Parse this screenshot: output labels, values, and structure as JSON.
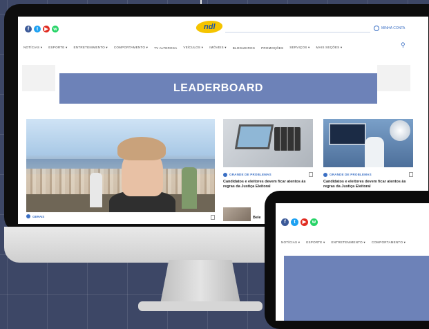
{
  "desktop": {
    "social_icons": [
      {
        "name": "facebook-icon",
        "glyph": "f"
      },
      {
        "name": "twitter-icon",
        "glyph": "t"
      },
      {
        "name": "youtube-icon",
        "glyph": "▶"
      },
      {
        "name": "whatsapp-icon",
        "glyph": "w"
      }
    ],
    "logo_text": "ndl",
    "account_label": "MINHA CONTA",
    "nav": [
      "NOTÍCIAS ▾",
      "ESPORTE ▾",
      "ENTRETENIMENTO ▾",
      "COMPORTAMENTO ▾",
      "TV ALTEROSA",
      "VEÍCULOS ▾",
      "IMÓVEIS ▾",
      "BLOGUEIROS",
      "PROMOÇÕES",
      "SERVIÇOS ▾",
      "MAIS SEÇÕES ▾"
    ],
    "search_glyph": "⚲",
    "leaderboard_label": "LEADERBOARD",
    "cards": [
      {
        "category": "GRANDE DE PROBLEMAS",
        "headline": "Candidatos e eleitores devem ficar atentos às regras da Justiça Eleitoral"
      },
      {
        "category": "GRANDE DE PROBLEMAS",
        "headline": "Candidatos e eleitores devem ficar atentos às regras da Justiça Eleitoral"
      }
    ],
    "hero_category": "GERAIS",
    "card3_headline": "Bele"
  },
  "tablet": {
    "nav": [
      "NOTÍCIAS ▾",
      "ESPORTE ▾",
      "ENTRETENIMENTO ▾",
      "COMPORTAMENTO ▾"
    ]
  },
  "colors": {
    "background": "#3d4766",
    "accent_blue": "#3a6fc4",
    "ad_slot": "#6d82b8",
    "logo_yellow": "#f5c400"
  }
}
